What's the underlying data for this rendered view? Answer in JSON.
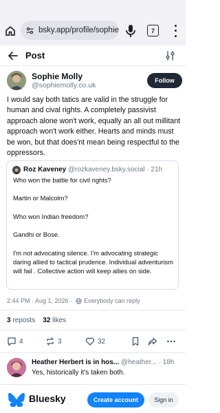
{
  "browser": {
    "url": "bsky.app/profile/sophier",
    "tab_count": "7"
  },
  "header": {
    "title": "Post"
  },
  "post": {
    "author_name": "Sophie Molly",
    "author_handle": "@sophiemolly.co.uk",
    "follow_label": "Follow",
    "text": "I would say both tatics are valid in the struggle for human and cival rights. A completely passivist approach alone won't work, equally an all out millitant approach won't work either. Hearts and minds must be won, but that does'nt mean being respectful to the oppressors.",
    "timestamp": "2:44 PM · Aug 1, 2026 ·",
    "reply_permission": "Everybody can reply",
    "reposts_count": "3",
    "reposts_label": "reposts",
    "likes_count": "32",
    "likes_label": "likes",
    "replies": "4",
    "reposts_action": "3",
    "likes_action": "32"
  },
  "quote": {
    "author_name": "Roz Kaveney",
    "author_handle": "@rozkaveney.bsky.social",
    "time": "· 21h",
    "lines": [
      "Who won the battle for civil rights?",
      "",
      "Martin or Malcolm?",
      "",
      "Who won Indian freedom?",
      "",
      "Gandhi or Bose.",
      "",
      "I'm not advocating silence. I'm advocating strategic daring allied to tactical prudence. Individual adventurism will fail . Collective action will keep allies on side."
    ]
  },
  "reply": {
    "author_name": "Heather Herbert is in hos...",
    "author_handle": "@heather...",
    "time": "· 18h",
    "text": "Yes, historically it's taken both."
  },
  "bottom_bar": {
    "brand": "Bluesky",
    "create_account_label": "Create account",
    "sign_in_label": "Sign in"
  },
  "colors": {
    "accent": "#1083fe",
    "follow_bg": "#1f2a36",
    "muted_text": "#6f7b88"
  }
}
